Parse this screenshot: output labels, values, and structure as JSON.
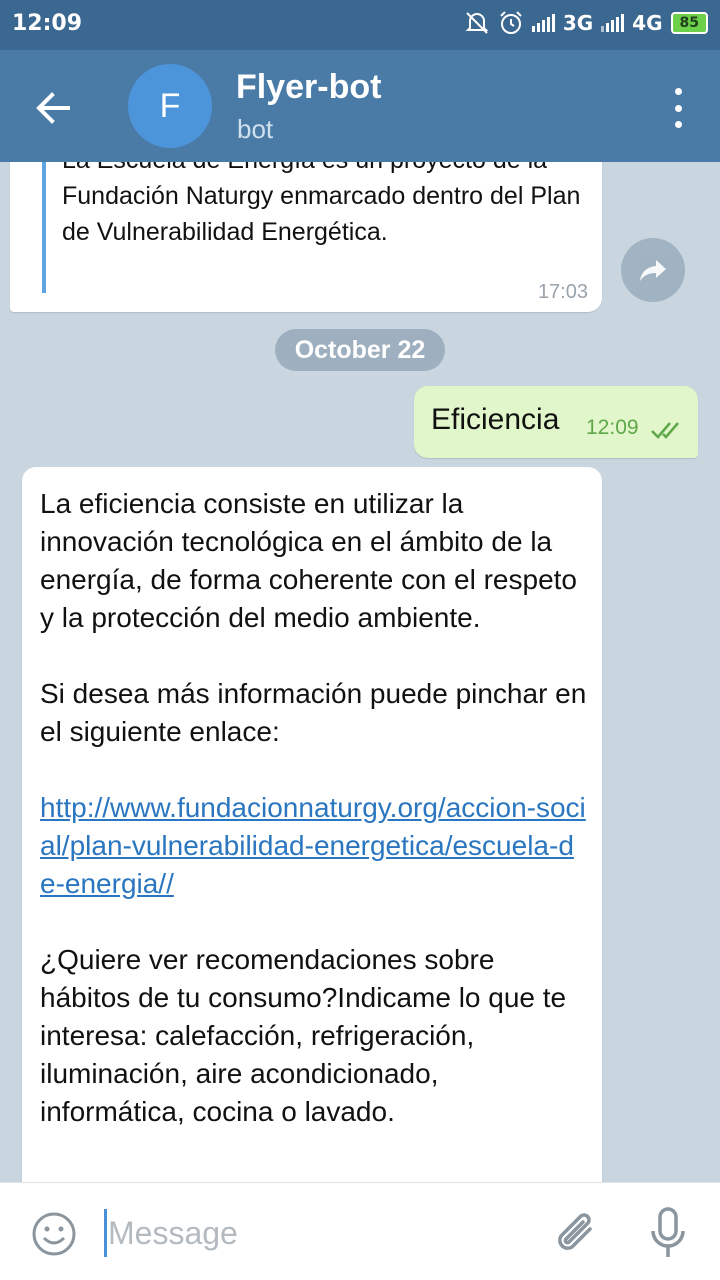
{
  "status_bar": {
    "time": "12:09",
    "network_1": "3G",
    "network_2": "4G",
    "battery": "85"
  },
  "header": {
    "avatar_letter": "F",
    "title": "Flyer-bot",
    "subtitle": "bot"
  },
  "messages": {
    "quoted": {
      "text": "La Escuela de Energía es un proyecto de la Fundación Naturgy enmarcado dentro del Plan de Vulnerabilidad Energética.",
      "time": "17:03"
    },
    "date_separator": "October 22",
    "outgoing": {
      "text": "Eficiencia",
      "time": "12:09"
    },
    "incoming": {
      "para1": "La eficiencia consiste en utilizar la innovación tecnológica en el ámbito de la energía, de forma coherente con el respeto y la protección del medio ambiente.",
      "para2": "Si desea más información puede pinchar en el siguiente enlace:",
      "link": "http://www.fundacionnaturgy.org/accion-social/plan-vulnerabilidad-energetica/escuela-de-energia//",
      "para3": "¿Quiere ver recomendaciones sobre hábitos de tu consumo?Indicame lo que te interesa: calefacción, refrigeración, iluminación, aire acondicionado, informática, cocina o lavado."
    }
  },
  "input": {
    "placeholder": "Message"
  },
  "colors": {
    "header": "#4a7aa6",
    "status_bar": "#3b6890",
    "outgoing_bubble": "#e1f6cb",
    "link": "#2a76c0",
    "battery": "#6cd04a"
  }
}
